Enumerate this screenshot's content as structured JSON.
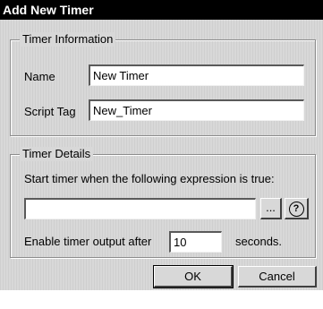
{
  "window": {
    "title": "Add New Timer"
  },
  "timer_information": {
    "legend": "Timer Information",
    "name_label": "Name",
    "name_value": "New Timer",
    "script_tag_label": "Script Tag",
    "script_tag_value": "New_Timer"
  },
  "timer_details": {
    "legend": "Timer Details",
    "expression_prompt": "Start timer when the following expression is true:",
    "expression_value": "",
    "browse_button_label": "...",
    "help_icon": "question-circle-icon",
    "output_label": "Enable timer output after",
    "output_value": "10",
    "output_unit": "seconds."
  },
  "buttons": {
    "ok_label": "OK",
    "cancel_label": "Cancel"
  }
}
